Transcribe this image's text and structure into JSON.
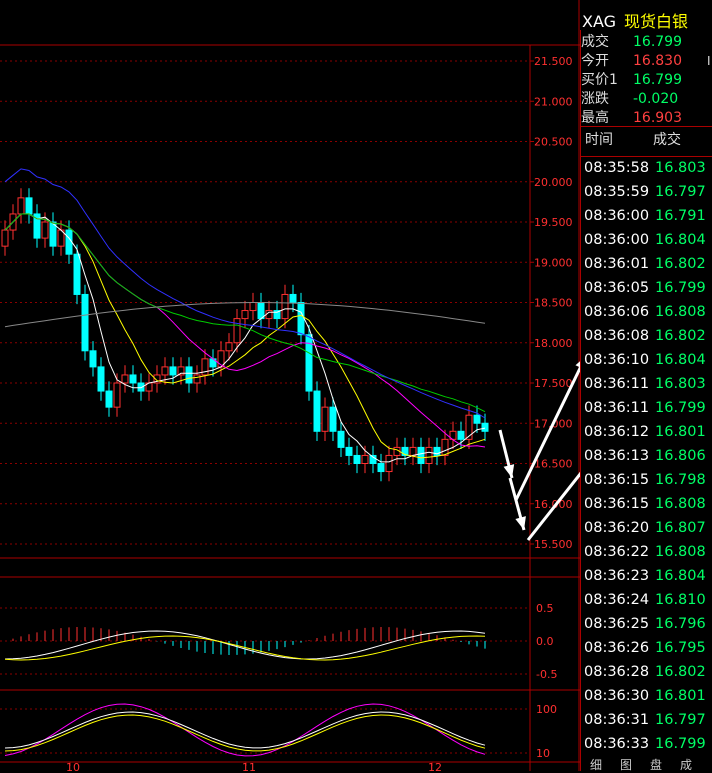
{
  "header": {
    "symbol": "XAG",
    "name": "现货白银"
  },
  "quote": [
    {
      "label": "成交",
      "value": "16.799",
      "color": "#00ff66",
      "extra": ""
    },
    {
      "label": "今开",
      "value": "16.830",
      "color": "#ff4040",
      "extra": "I"
    },
    {
      "label": "买价1",
      "value": "16.799",
      "color": "#00ff66",
      "extra": ""
    },
    {
      "label": "涨跌",
      "value": "-0.020",
      "color": "#00ff66",
      "extra": ""
    },
    {
      "label": "最高",
      "value": "16.903",
      "color": "#ff4040",
      "extra": ""
    }
  ],
  "ticks_header": {
    "time": "时间",
    "price": "成交"
  },
  "ticks": [
    {
      "time": "08:35:58",
      "price": "16.803"
    },
    {
      "time": "08:35:59",
      "price": "16.797"
    },
    {
      "time": "08:36:00",
      "price": "16.791"
    },
    {
      "time": "08:36:00",
      "price": "16.804"
    },
    {
      "time": "08:36:01",
      "price": "16.802"
    },
    {
      "time": "08:36:05",
      "price": "16.799"
    },
    {
      "time": "08:36:06",
      "price": "16.808"
    },
    {
      "time": "08:36:08",
      "price": "16.802"
    },
    {
      "time": "08:36:10",
      "price": "16.804"
    },
    {
      "time": "08:36:11",
      "price": "16.803"
    },
    {
      "time": "08:36:11",
      "price": "16.799"
    },
    {
      "time": "08:36:12",
      "price": "16.801"
    },
    {
      "time": "08:36:13",
      "price": "16.806"
    },
    {
      "time": "08:36:15",
      "price": "16.798"
    },
    {
      "time": "08:36:15",
      "price": "16.808"
    },
    {
      "time": "08:36:20",
      "price": "16.807"
    },
    {
      "time": "08:36:22",
      "price": "16.808"
    },
    {
      "time": "08:36:23",
      "price": "16.804"
    },
    {
      "time": "08:36:24",
      "price": "16.810"
    },
    {
      "time": "08:36:25",
      "price": "16.796"
    },
    {
      "time": "08:36:26",
      "price": "16.795"
    },
    {
      "time": "08:36:28",
      "price": "16.802"
    },
    {
      "time": "08:36:30",
      "price": "16.801"
    },
    {
      "time": "08:36:31",
      "price": "16.797"
    },
    {
      "time": "08:36:33",
      "price": "16.799"
    }
  ],
  "price_axis": [
    "21.500",
    "21.000",
    "20.500",
    "20.000",
    "19.500",
    "19.000",
    "18.500",
    "18.000",
    "17.500",
    "17.000",
    "16.500",
    "16.000",
    "15.500"
  ],
  "macd_axis": [
    "0.5",
    "0.0",
    "-0.5"
  ],
  "kdj_axis": [
    "100",
    "10"
  ],
  "date_labels": [
    "10",
    "11",
    "12"
  ],
  "bottom_tabs": [
    "细",
    "图",
    "盘",
    "成"
  ]
}
